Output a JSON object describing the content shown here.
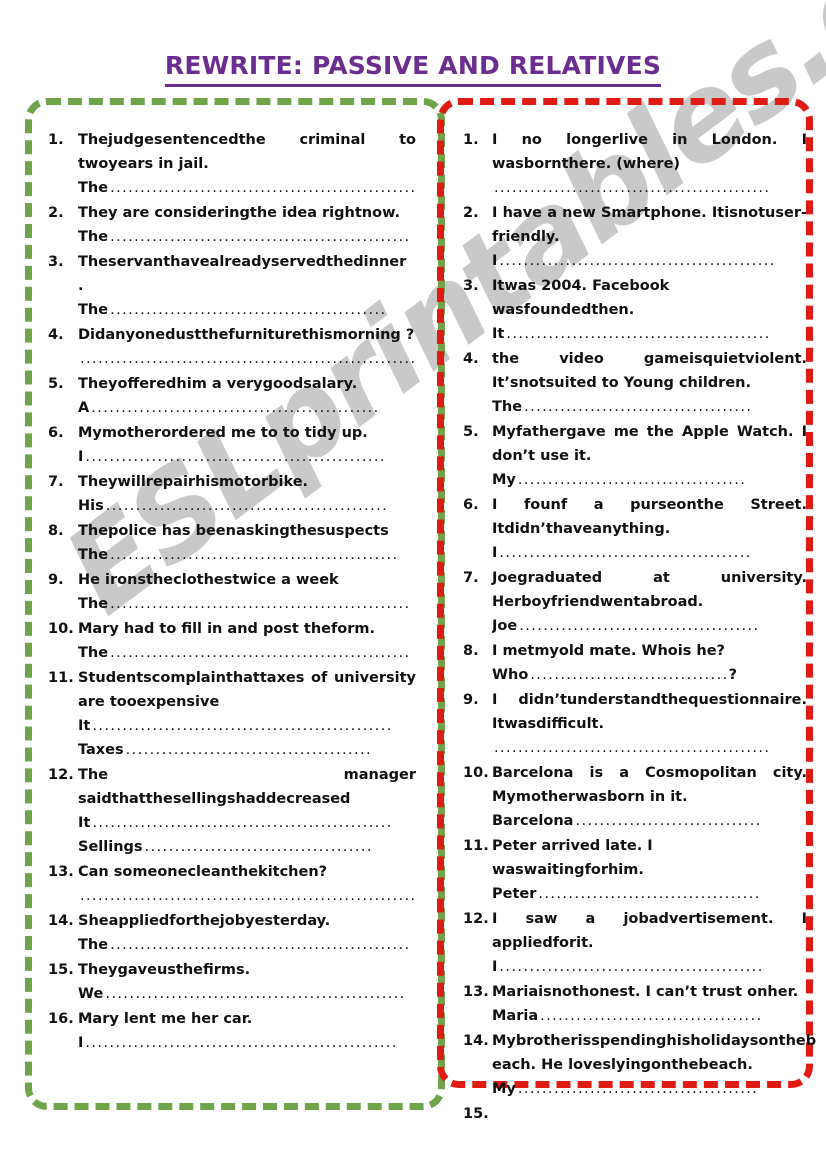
{
  "page": {
    "title": "REWRITE: PASSIVE AND RELATIVES",
    "watermark": "ESLprintables.com",
    "accent_title_color": "#6b2d8f",
    "left_border_color": "#70a44a",
    "right_border_color": "#e01b14"
  },
  "left_column": {
    "name": "passive-voice-exercises",
    "items": [
      {
        "prompt": "Thejudgesentencedthe criminal to twoyears in jail.",
        "answers": [
          {
            "lead": "The",
            "dots": "..........................................................",
            "tail": ""
          }
        ]
      },
      {
        "prompt": "They are consideringthe idea rightnow.",
        "answers": [
          {
            "lead": "The",
            "dots": "..................................................",
            "tail": ""
          }
        ]
      },
      {
        "prompt": "Theservanthavealreadyservedthedinner .",
        "answers": [
          {
            "lead": "The",
            "dots": "..............................................",
            "tail": ""
          }
        ]
      },
      {
        "prompt": "Didanyonedustthefurniturethismorning ?",
        "answers": [
          {
            "lead": "",
            "dots": ".............................................................",
            "tail": "?"
          }
        ]
      },
      {
        "prompt": "Theyofferedhim a verygoodsalary.",
        "answers": [
          {
            "lead": "A",
            "dots": "................................................",
            "tail": ""
          }
        ]
      },
      {
        "prompt": "Mymotherordered me to to tidy up.",
        "answers": [
          {
            "lead": "I",
            "dots": "..................................................",
            "tail": ""
          }
        ]
      },
      {
        "prompt": "Theywillrepairhismotorbike.",
        "answers": [
          {
            "lead": "His",
            "dots": "...............................................",
            "tail": ""
          }
        ]
      },
      {
        "prompt": "Thepolice has beenaskingthesuspects",
        "answers": [
          {
            "lead": "The",
            "dots": "................................................",
            "tail": ""
          }
        ]
      },
      {
        "prompt": "He ironstheclothestwice a week",
        "answers": [
          {
            "lead": "The",
            "dots": "..................................................",
            "tail": ""
          }
        ]
      },
      {
        "prompt": "Mary had to fill in and post theform.",
        "answers": [
          {
            "lead": "The",
            "dots": "..................................................",
            "tail": ""
          }
        ]
      },
      {
        "prompt": "Studentscomplainthattaxes of university are tooexpensive",
        "answers": [
          {
            "lead": "It",
            "dots": "..................................................",
            "tail": ""
          },
          {
            "lead": "Taxes",
            "dots": ".........................................",
            "tail": ""
          }
        ]
      },
      {
        "prompt": "The manager saidthatthesellingshaddecreased",
        "answers": [
          {
            "lead": "It",
            "dots": "..................................................",
            "tail": ""
          },
          {
            "lead": "Sellings",
            "dots": "......................................",
            "tail": ""
          }
        ]
      },
      {
        "prompt": "Can someonecleanthekitchen?",
        "answers": [
          {
            "lead": "",
            "dots": "..............................................................",
            "tail": "?"
          }
        ]
      },
      {
        "prompt": "Sheappliedforthejobyesterday.",
        "answers": [
          {
            "lead": "The",
            "dots": "..................................................",
            "tail": ""
          }
        ]
      },
      {
        "prompt": "Theygaveusthefirms.",
        "answers": [
          {
            "lead": "We",
            "dots": "..................................................",
            "tail": ""
          }
        ]
      },
      {
        "prompt": "Mary lent me her car.",
        "answers": [
          {
            "lead": "I",
            "dots": "....................................................",
            "tail": ""
          }
        ]
      }
    ]
  },
  "right_column": {
    "name": "relative-clause-exercises",
    "items": [
      {
        "prompt": "I no longerlive in London. I wasbornthere. (where)",
        "answers": [
          {
            "lead": "",
            "dots": "..............................................",
            "tail": ""
          }
        ]
      },
      {
        "prompt": "I have a new Smartphone. Itisnotuser-friendly.",
        "answers": [
          {
            "lead": "I",
            "dots": "..............................................",
            "tail": ""
          }
        ]
      },
      {
        "prompt": "Itwas 2004. Facebook wasfoundedthen.",
        "answers": [
          {
            "lead": "It",
            "dots": "............................................",
            "tail": ""
          }
        ]
      },
      {
        "prompt": "the video gameisquietviolent. It’snotsuited to Young children.",
        "answers": [
          {
            "lead": "The",
            "dots": "......................................",
            "tail": ""
          }
        ]
      },
      {
        "prompt": "Myfathergave me the Apple Watch. I don’t use it.",
        "answers": [
          {
            "lead": "My",
            "dots": "......................................",
            "tail": ""
          }
        ]
      },
      {
        "prompt": "I founf a purseonthe Street. Itdidn’thaveanything.",
        "answers": [
          {
            "lead": "I",
            "dots": "..........................................",
            "tail": ""
          }
        ]
      },
      {
        "prompt": "Joegraduated at university. Herboyfriendwentabroad.",
        "answers": [
          {
            "lead": "Joe",
            "dots": "........................................",
            "tail": ""
          }
        ]
      },
      {
        "prompt": "I metmyold mate. Whois he?",
        "answers": [
          {
            "lead": "Who",
            "dots": ".................................",
            "tail": "?"
          }
        ]
      },
      {
        "prompt": "I didn’tunderstandthequestionnaire. Itwasdifficult.",
        "answers": [
          {
            "lead": "",
            "dots": "..............................................",
            "tail": ""
          }
        ]
      },
      {
        "prompt": "Barcelona is a Cosmopolitan city. Mymotherwasborn in it.",
        "answers": [
          {
            "lead": "Barcelona",
            "dots": "...............................",
            "tail": ""
          }
        ]
      },
      {
        "prompt": "Peter arrived late. I waswaitingforhim.",
        "answers": [
          {
            "lead": "Peter",
            "dots": ".....................................",
            "tail": ""
          }
        ]
      },
      {
        "prompt": "I saw a jobadvertisement. I appliedforit.",
        "answers": [
          {
            "lead": "I",
            "dots": "............................................",
            "tail": ""
          }
        ]
      },
      {
        "prompt": "Mariaisnothonest. I can’t trust onher.",
        "answers": [
          {
            "lead": "Maria",
            "dots": ".....................................",
            "tail": ""
          }
        ]
      },
      {
        "prompt": "Mybrotherisspendinghisholidaysontheb each. He loveslyingonthebeach.",
        "answers": [
          {
            "lead": "My",
            "dots": "........................................",
            "tail": ""
          }
        ]
      },
      {
        "prompt": "",
        "answers": [],
        "plain": true
      }
    ]
  }
}
